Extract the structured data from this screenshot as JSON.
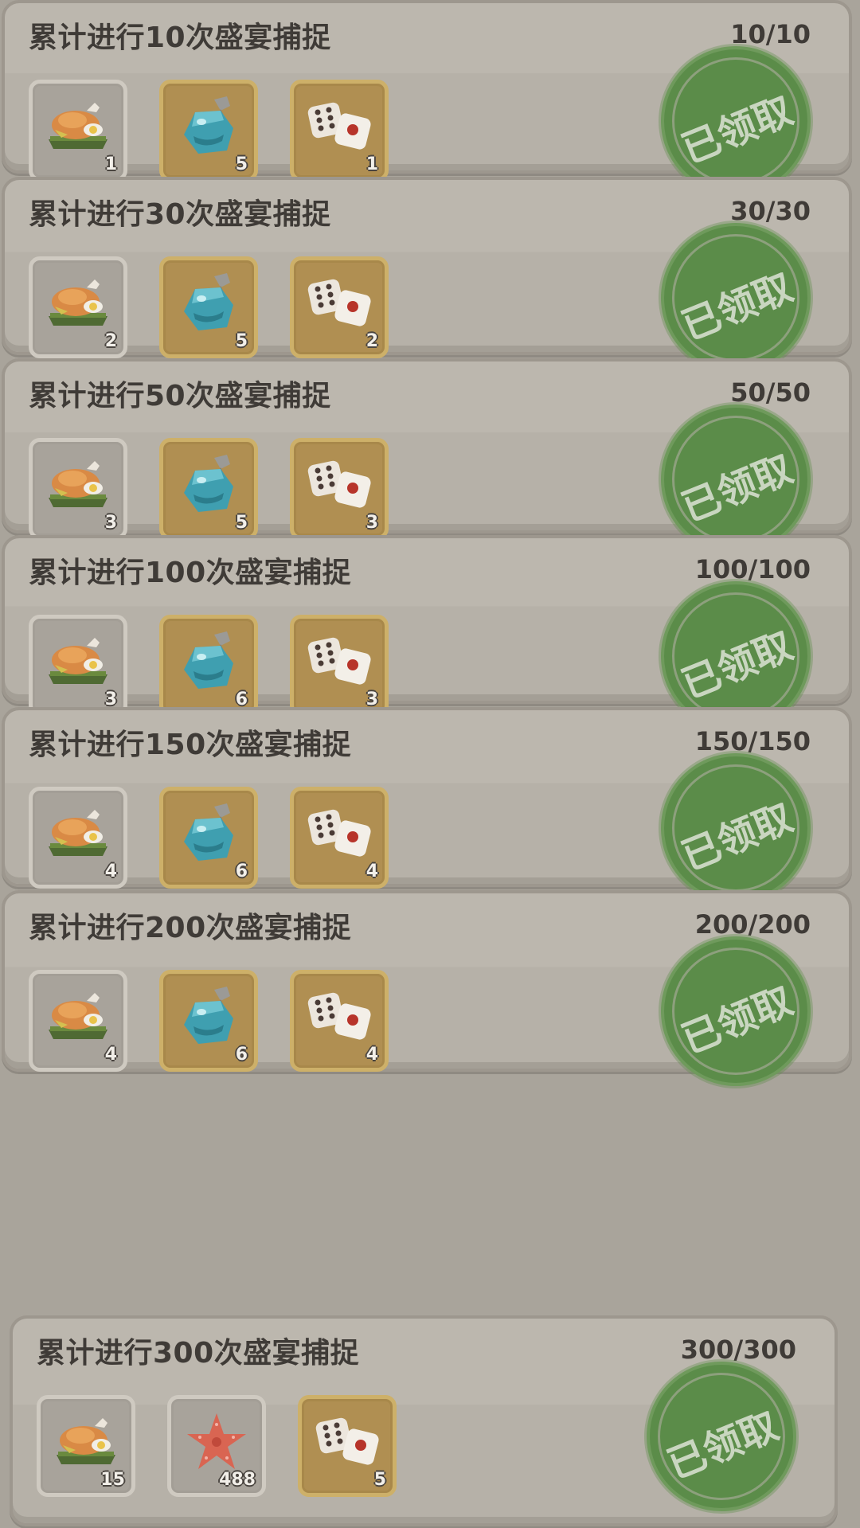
{
  "colors": {
    "stamp": "#5b8c49",
    "card": "#bcb7ae",
    "gold_frame": "#cdb069",
    "grey_frame": "#cfcac1"
  },
  "stamp_label": "已领取",
  "tasks": [
    {
      "title": "累计进行10次盛宴捕捉",
      "progress": "10/10",
      "rewards": [
        {
          "icon": "feast-plate-icon",
          "frame": "grey",
          "count": "1"
        },
        {
          "icon": "blue-potion-icon",
          "frame": "gold",
          "count": "5"
        },
        {
          "icon": "dice-icon",
          "frame": "gold",
          "count": "1"
        }
      ]
    },
    {
      "title": "累计进行30次盛宴捕捉",
      "progress": "30/30",
      "rewards": [
        {
          "icon": "feast-plate-icon",
          "frame": "grey",
          "count": "2"
        },
        {
          "icon": "blue-potion-icon",
          "frame": "gold",
          "count": "5"
        },
        {
          "icon": "dice-icon",
          "frame": "gold",
          "count": "2"
        }
      ]
    },
    {
      "title": "累计进行50次盛宴捕捉",
      "progress": "50/50",
      "rewards": [
        {
          "icon": "feast-plate-icon",
          "frame": "grey",
          "count": "3"
        },
        {
          "icon": "blue-potion-icon",
          "frame": "gold",
          "count": "5"
        },
        {
          "icon": "dice-icon",
          "frame": "gold",
          "count": "3"
        }
      ]
    },
    {
      "title": "累计进行100次盛宴捕捉",
      "progress": "100/100",
      "rewards": [
        {
          "icon": "feast-plate-icon",
          "frame": "grey",
          "count": "3"
        },
        {
          "icon": "blue-potion-icon",
          "frame": "gold",
          "count": "6"
        },
        {
          "icon": "dice-icon",
          "frame": "gold",
          "count": "3"
        }
      ]
    },
    {
      "title": "累计进行150次盛宴捕捉",
      "progress": "150/150",
      "rewards": [
        {
          "icon": "feast-plate-icon",
          "frame": "grey",
          "count": "4"
        },
        {
          "icon": "blue-potion-icon",
          "frame": "gold",
          "count": "6"
        },
        {
          "icon": "dice-icon",
          "frame": "gold",
          "count": "4"
        }
      ]
    },
    {
      "title": "累计进行200次盛宴捕捉",
      "progress": "200/200",
      "rewards": [
        {
          "icon": "feast-plate-icon",
          "frame": "grey",
          "count": "4"
        },
        {
          "icon": "blue-potion-icon",
          "frame": "gold",
          "count": "6"
        },
        {
          "icon": "dice-icon",
          "frame": "gold",
          "count": "4"
        }
      ]
    },
    {
      "title": "累计进行300次盛宴捕捉",
      "progress": "300/300",
      "rewards": [
        {
          "icon": "feast-plate-icon",
          "frame": "grey",
          "count": "15"
        },
        {
          "icon": "starfish-icon",
          "frame": "grey",
          "count": "488"
        },
        {
          "icon": "dice-icon",
          "frame": "gold",
          "count": "5"
        }
      ]
    }
  ]
}
